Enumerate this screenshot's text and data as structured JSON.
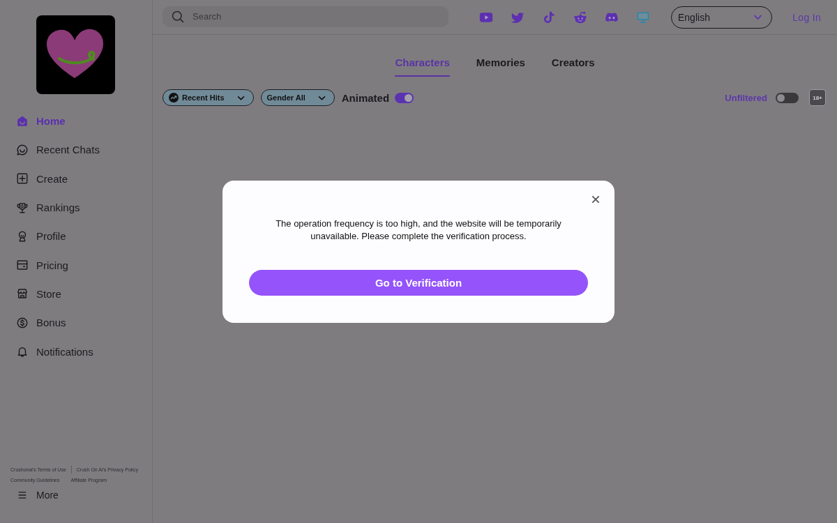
{
  "sidebar": {
    "items": [
      {
        "label": "Home",
        "selected": true
      },
      {
        "label": "Recent Chats",
        "selected": false
      },
      {
        "label": "Create",
        "selected": false
      },
      {
        "label": "Rankings",
        "selected": false
      },
      {
        "label": "Profile",
        "selected": false
      },
      {
        "label": "Pricing",
        "selected": false
      },
      {
        "label": "Store",
        "selected": false
      },
      {
        "label": "Bonus",
        "selected": false
      },
      {
        "label": "Notifications",
        "selected": false
      }
    ],
    "footer_links": [
      "Crushonai's Terms of Use",
      "Crush On Ai's Privacy Policy",
      "Community Guidelines",
      "Affiliate Program"
    ],
    "more": "More"
  },
  "top_bar": {
    "search": {
      "placeholder": "Search"
    },
    "language": {
      "value": "English"
    },
    "login": "Log In"
  },
  "tabs": [
    {
      "label": "Characters",
      "selected": true
    },
    {
      "label": "Memories",
      "selected": false
    },
    {
      "label": "Creators",
      "selected": false
    }
  ],
  "filters": {
    "dropdowns": [
      {
        "label": "Recent Hits"
      },
      {
        "label": "Gender All"
      }
    ],
    "animated": {
      "label": "Animated",
      "on": true
    },
    "unfiltered": {
      "label": "Unfiltered",
      "on": false
    },
    "adult_badge": "18+"
  },
  "dialog": {
    "message": "The operation frequency is too high, and the website will be temporarily unavailable. Please complete the verification process.",
    "button": "Go to Verification"
  }
}
